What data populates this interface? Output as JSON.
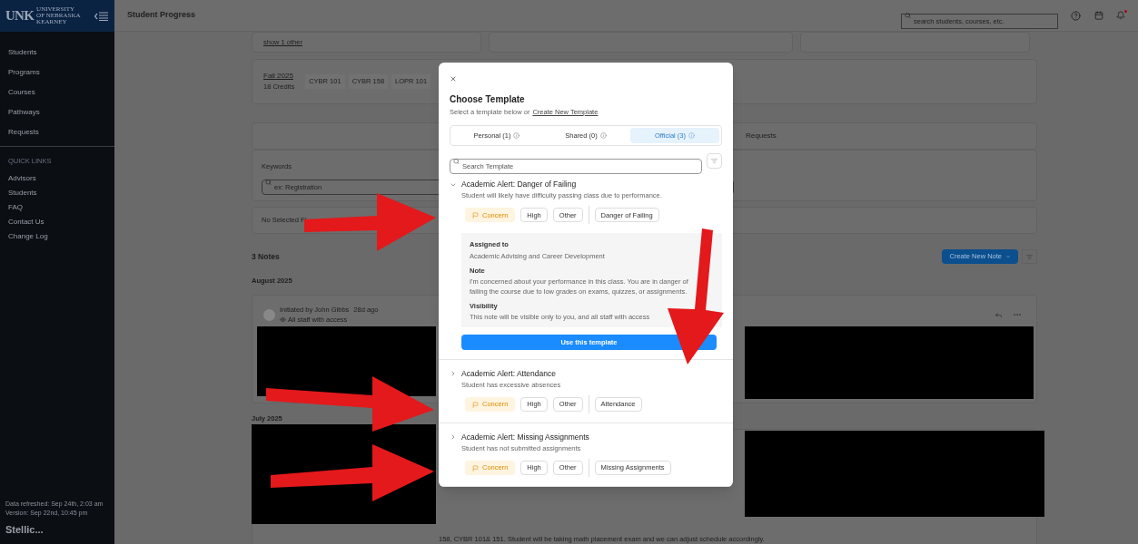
{
  "sidebar": {
    "logo": {
      "mark": "UNK",
      "lines": [
        "UNIVERSITY",
        "OF NEBRASKA",
        "KEARNEY"
      ]
    },
    "nav": [
      "Students",
      "Programs",
      "Courses",
      "Pathways",
      "Requests"
    ],
    "quick_links_heading": "QUICK LINKS",
    "quick_links": [
      "Advisors",
      "Students",
      "FAQ",
      "Contact Us",
      "Change Log"
    ],
    "data_refreshed": "Data refreshed: Sep 24th, 2:03 am",
    "version": "Version: Sep 22nd, 10:45 pm",
    "brand": "Stellic..."
  },
  "header": {
    "title": "Student Progress",
    "search_placeholder": "search students, courses, etc.",
    "has_notification": true
  },
  "page": {
    "show_other": "show 1 other",
    "term": {
      "name": "Fall 2025",
      "credits": "18 Credits",
      "courses": [
        "CYBR 101",
        "CYBR 158",
        "LOPR 101"
      ]
    },
    "tab_label": "Requests",
    "keywords_label": "Keywords",
    "keywords_placeholder": "ex: Registration",
    "filters_text": "No Selected Fi",
    "notes_count": "3 Notes",
    "create_button": "Create New Note",
    "groups": [
      {
        "month": "August 2025",
        "note": {
          "author": "Initiated by John Gibbs",
          "age": "28d ago",
          "visibility": "All staff with access"
        }
      },
      {
        "month": "July 2025",
        "text": "158, CYBR 101& 151. Student will be taking math placement exam and we can adjust schedule accordingly."
      }
    ]
  },
  "modal": {
    "title": "Choose Template",
    "subtitle": "Select a template below or",
    "subtitle_link": "Create New Template",
    "tabs": [
      {
        "label": "Personal (1)",
        "selected": false
      },
      {
        "label": "Shared (0)",
        "selected": false
      },
      {
        "label": "Official (3)",
        "selected": true
      }
    ],
    "search_placeholder": "Search Template",
    "templates": [
      {
        "title": "Academic Alert: Danger of Failing",
        "description": "Student will likely have difficulty passing class due to performance.",
        "expanded": true,
        "tags": [
          {
            "label": "Concern",
            "kind": "category"
          },
          {
            "label": "High",
            "kind": "plain"
          },
          {
            "label": "Other",
            "kind": "plain"
          },
          {
            "label": "Danger of Failing",
            "kind": "reason"
          }
        ],
        "details": [
          {
            "heading": "Assigned to",
            "text": "Academic Advising and Career Development"
          },
          {
            "heading": "Note",
            "text": "I'm concerned about your performance in this class. You are in danger of failing the course due to low grades on exams, quizzes, or assignments."
          },
          {
            "heading": "Visibility",
            "text": "This note will be visible only to you, and all staff with access"
          }
        ],
        "action": "Use this template"
      },
      {
        "title": "Academic Alert: Attendance",
        "description": "Student has excessive absences",
        "expanded": false,
        "tags": [
          {
            "label": "Concern",
            "kind": "category"
          },
          {
            "label": "High",
            "kind": "plain"
          },
          {
            "label": "Other",
            "kind": "plain"
          },
          {
            "label": "Attendance",
            "kind": "reason"
          }
        ]
      },
      {
        "title": "Academic Alert: Missing Assignments",
        "description": "Student has not submitted assignments",
        "expanded": false,
        "tags": [
          {
            "label": "Concern",
            "kind": "category"
          },
          {
            "label": "High",
            "kind": "plain"
          },
          {
            "label": "Other",
            "kind": "plain"
          },
          {
            "label": "Missing Assignments",
            "kind": "reason"
          }
        ]
      }
    ]
  }
}
